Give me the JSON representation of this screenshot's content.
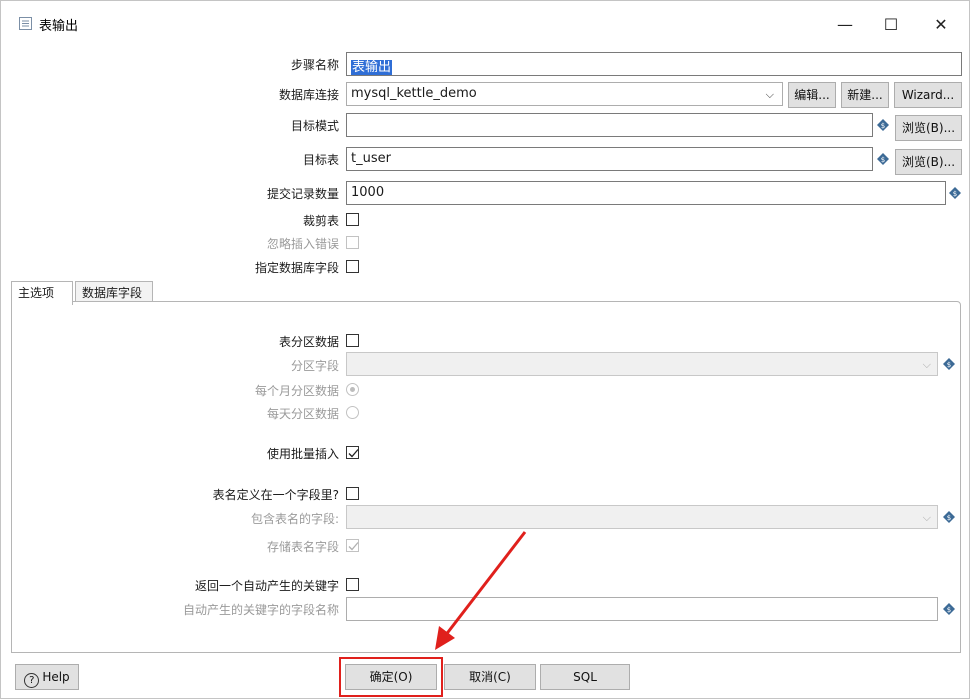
{
  "window": {
    "title": "表输出",
    "minimize_symbol": "—",
    "maximize_symbol": "☐",
    "close_symbol": "✕"
  },
  "form": {
    "step_name_label": "步骤名称",
    "step_name_value": "表输出",
    "connection_label": "数据库连接",
    "connection_value": "mysql_kettle_demo",
    "edit_btn": "编辑...",
    "new_btn": "新建...",
    "wizard_btn": "Wizard...",
    "target_schema_label": "目标模式",
    "target_schema_value": "",
    "browse_btn_1": "浏览(B)...",
    "target_table_label": "目标表",
    "target_table_value": "t_user",
    "browse_btn_2": "浏览(B)...",
    "commit_size_label": "提交记录数量",
    "commit_size_value": "1000",
    "truncate_label": "裁剪表",
    "truncate_checked": false,
    "ignore_errors_label": "忽略插入错误",
    "ignore_errors_checked": false,
    "specify_fields_label": "指定数据库字段",
    "specify_fields_checked": false
  },
  "tabs": [
    {
      "label": "主选项",
      "active": true
    },
    {
      "label": "数据库字段",
      "active": false
    }
  ],
  "main_tab": {
    "partition_label": "表分区数据",
    "partition_checked": false,
    "partition_field_label": "分区字段",
    "partition_field_value": "",
    "monthly_label": "每个月分区数据",
    "monthly_selected": true,
    "daily_label": "每天分区数据",
    "daily_selected": false,
    "batch_label": "使用批量插入",
    "batch_checked": true,
    "table_in_field_label": "表名定义在一个字段里?",
    "table_in_field_checked": false,
    "table_field_label": "包含表名的字段:",
    "table_field_value": "",
    "store_table_label": "存储表名字段",
    "store_table_checked": true,
    "return_key_label": "返回一个自动产生的关键字",
    "return_key_checked": false,
    "key_field_label": "自动产生的关键字的字段名称",
    "key_field_value": ""
  },
  "footer": {
    "help_btn": "Help",
    "help_icon_glyph": "?",
    "ok_btn": "确定(O)",
    "cancel_btn": "取消(C)",
    "sql_btn": "SQL"
  },
  "colors": {
    "highlight": "#e0201c",
    "selection": "#2f6ed6",
    "variable_icon": "#3c6a96"
  }
}
